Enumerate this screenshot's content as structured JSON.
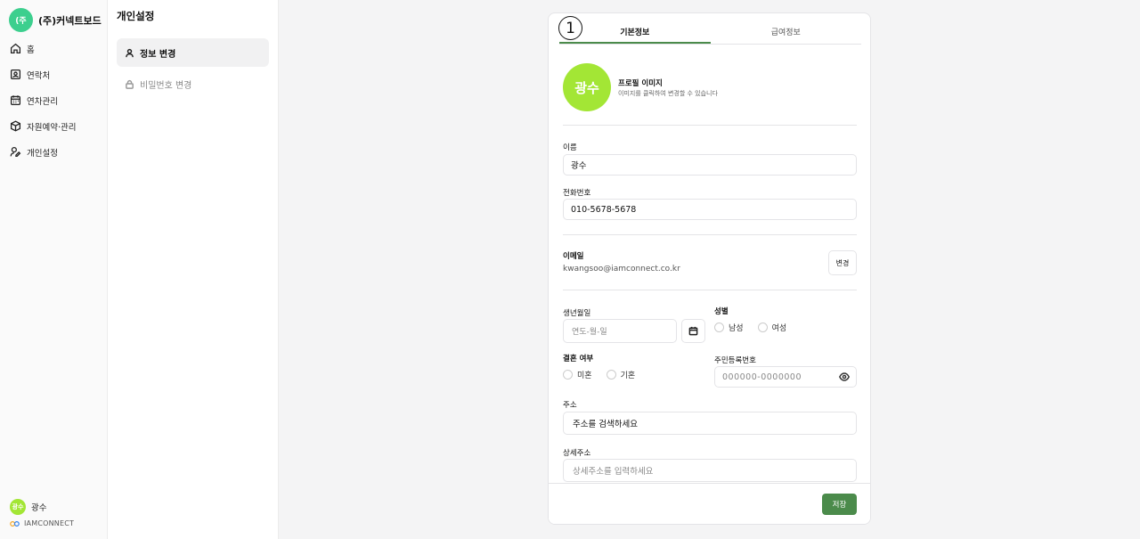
{
  "brand": {
    "logo_text": "(주",
    "name": "(주)커넥트보드"
  },
  "nav": [
    {
      "label": "홈",
      "icon": "home-icon"
    },
    {
      "label": "연락처",
      "icon": "contact-icon"
    },
    {
      "label": "연차관리",
      "icon": "calendar-icon"
    },
    {
      "label": "자원예약·관리",
      "icon": "box-icon"
    },
    {
      "label": "개인설정",
      "icon": "user-edit-icon"
    }
  ],
  "user": {
    "avatar": "광수",
    "name": "광수"
  },
  "company_label": "IAMCONNECT",
  "submenu": {
    "title": "개인설정",
    "items": [
      {
        "label": "정보 변경",
        "icon": "user-icon",
        "active": true
      },
      {
        "label": "비밀번호 변경",
        "icon": "lock-icon",
        "active": false
      }
    ]
  },
  "card": {
    "step_marker": "1",
    "tabs": [
      {
        "label": "기본정보",
        "active": true
      },
      {
        "label": "급여정보",
        "active": false
      }
    ],
    "profile": {
      "avatar": "광수",
      "title": "프로필 이미지",
      "hint": "이미지를 클릭하여 변경할 수 있습니다"
    },
    "name": {
      "label": "이름",
      "value": "광수"
    },
    "phone": {
      "label": "전화번호",
      "value": "010-5678-5678"
    },
    "email": {
      "label": "이메일",
      "value": "kwangsoo@iamconnect.co.kr",
      "change_button": "변경"
    },
    "birth": {
      "label": "생년월일",
      "placeholder": "연도-월-일"
    },
    "gender": {
      "label": "성별",
      "options": [
        "남성",
        "여성"
      ]
    },
    "marriage": {
      "label": "결혼 여부",
      "options": [
        "미혼",
        "기혼"
      ]
    },
    "rrn": {
      "label": "주민등록번호",
      "placeholder": "000000-0000000"
    },
    "address": {
      "label": "주소",
      "placeholder": "주소를 검색하세요"
    },
    "detail_address": {
      "label": "상세주소",
      "placeholder": "상세주소를 입력하세요"
    },
    "save_button": "저장"
  },
  "colors": {
    "brand_green": "#3ccf8e",
    "avatar_lime": "#a3e635",
    "accent": "#4b8b4b"
  }
}
